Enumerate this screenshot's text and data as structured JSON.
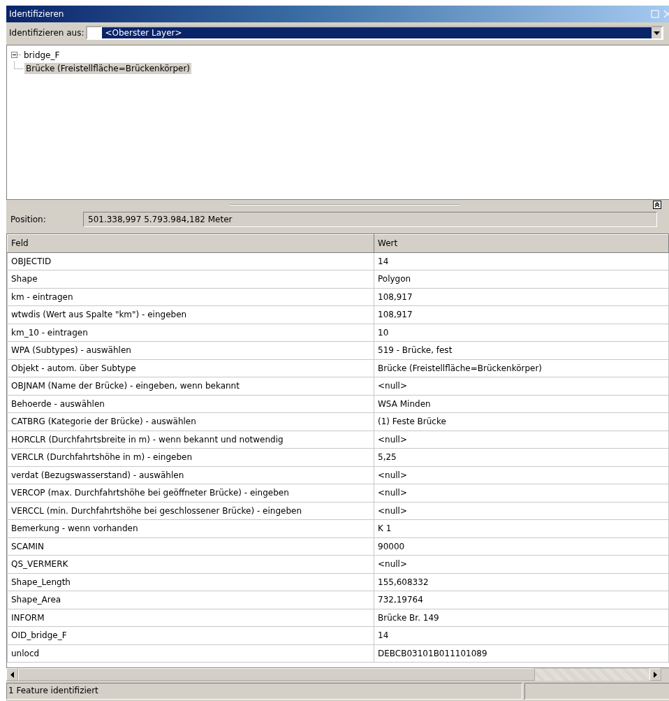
{
  "window": {
    "title": "Identifizieren"
  },
  "identify_from": {
    "label": "Identifizieren aus:",
    "value": "<Oberster Layer>"
  },
  "tree": [
    {
      "label": "bridge_F",
      "expanded": true,
      "selected": false,
      "children": [
        {
          "label": "Brücke (Freistellfläche=Brückenkörper)",
          "selected": true
        }
      ]
    }
  ],
  "position": {
    "label": "Position:",
    "value": "501.338,997  5.793.984,182 Meter"
  },
  "table": {
    "columns": [
      "Feld",
      "Wert"
    ],
    "rows": [
      [
        "OBJECTID",
        "14"
      ],
      [
        "Shape",
        "Polygon"
      ],
      [
        "km - eintragen",
        "108,917"
      ],
      [
        "wtwdis (Wert aus Spalte \"km\") - eingeben",
        "108,917"
      ],
      [
        "km_10 - eintragen",
        "10"
      ],
      [
        "WPA (Subtypes) - auswählen",
        "519 - Brücke, fest"
      ],
      [
        "Objekt - autom. über Subtype",
        "Brücke (Freistellfläche=Brückenkörper)"
      ],
      [
        "OBJNAM (Name der Brücke) - eingeben, wenn bekannt",
        "<null>"
      ],
      [
        "Behoerde - auswählen",
        "WSA Minden"
      ],
      [
        "CATBRG (Kategorie der Brücke) - auswählen",
        "(1) Feste Brücke"
      ],
      [
        "HORCLR (Durchfahrtsbreite in m) - wenn bekannt und notwendig",
        "<null>"
      ],
      [
        "VERCLR (Durchfahrtshöhe in m) - eingeben",
        "5,25"
      ],
      [
        "verdat (Bezugswasserstand) - auswählen",
        "<null>"
      ],
      [
        "VERCOP (max. Durchfahrtshöhe bei geöffneter Brücke) - eingeben",
        "<null>"
      ],
      [
        "VERCCL (min. Durchfahrtshöhe bei geschlossener Brücke) - eingeben",
        "<null>"
      ],
      [
        "Bemerkung - wenn vorhanden",
        "K 1"
      ],
      [
        "SCAMIN",
        "90000"
      ],
      [
        "QS_VERMERK",
        "<null>"
      ],
      [
        "Shape_Length",
        "155,608332"
      ],
      [
        "Shape_Area",
        "732,19764"
      ],
      [
        "INFORM",
        "Brücke Br. 149"
      ],
      [
        "OID_bridge_F",
        "14"
      ],
      [
        "unlocd",
        "DEBCB03101B011101089"
      ]
    ]
  },
  "status_bar": "1 Feature identifiziert"
}
